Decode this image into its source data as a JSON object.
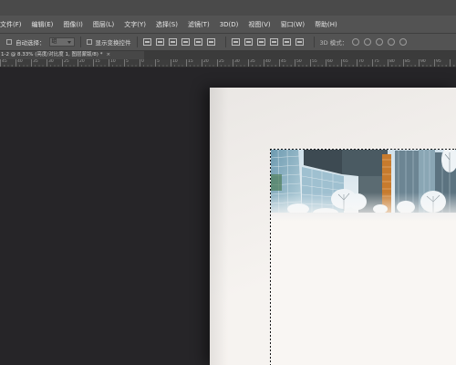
{
  "menu": {
    "items": [
      "文件(F)",
      "编辑(E)",
      "图像(I)",
      "图层(L)",
      "文字(Y)",
      "选择(S)",
      "滤镜(T)",
      "3D(D)",
      "视图(V)",
      "窗口(W)",
      "帮助(H)"
    ]
  },
  "options": {
    "auto_select_label": "自动选择：",
    "auto_select_value": "组",
    "show_transform_label": "显示变换控件",
    "mode_label": "3D 模式："
  },
  "document": {
    "tab_title": "1-2 @ 8.33% (亮度/对比度 1, 图层蒙版/8) *",
    "tab_close": "×"
  },
  "ruler": {
    "numbers": [
      "45",
      "40",
      "35",
      "30",
      "25",
      "20",
      "15",
      "10",
      "5",
      "0",
      "5",
      "10",
      "15",
      "20",
      "25",
      "30",
      "35",
      "40",
      "45",
      "50",
      "55",
      "60",
      "65",
      "70",
      "75",
      "80",
      "85",
      "90",
      "95"
    ]
  },
  "colors": {
    "menubar": "#535353",
    "workspace": "#262528",
    "artboard": "#f5f2ef"
  }
}
